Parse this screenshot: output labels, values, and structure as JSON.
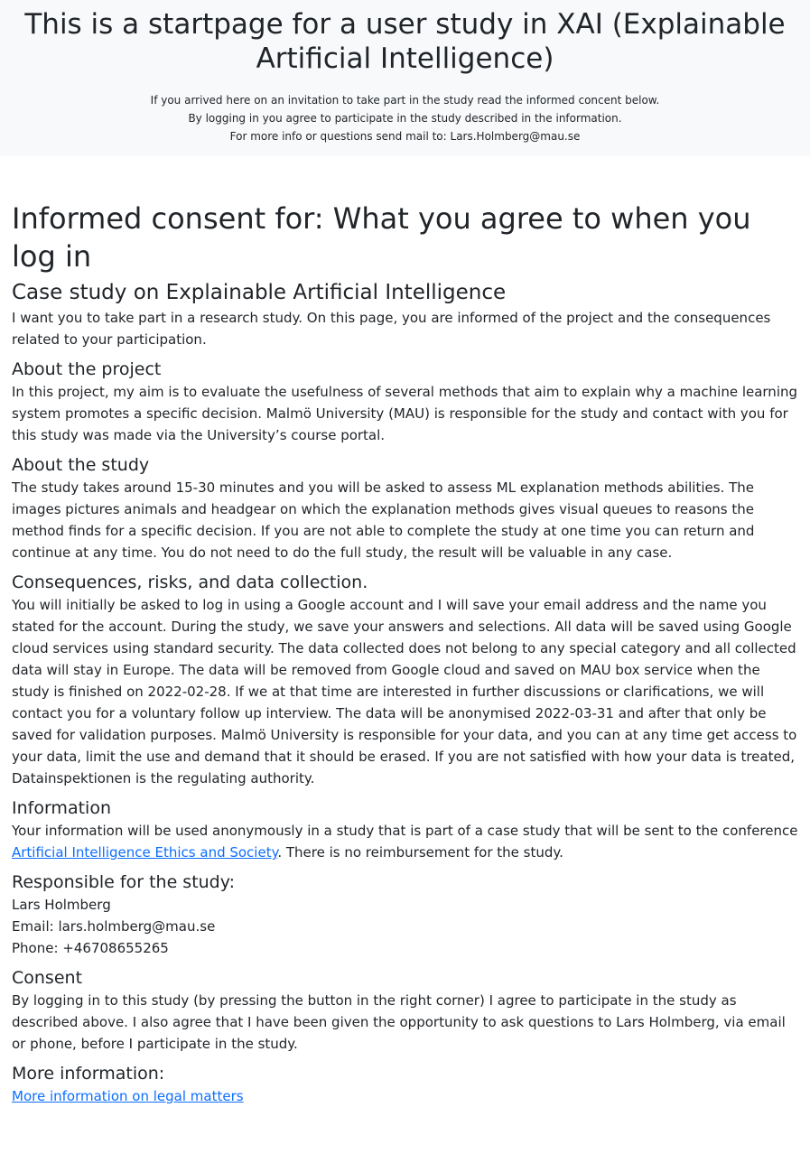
{
  "hero": {
    "title": "This is a startpage for a user study in XAI (Explainable Artificial Intelligence)",
    "line1": "If you arrived here on an invitation to take part in the study read the informed concent below.",
    "line2": "By logging in you agree to participate in the study described in the information.",
    "line3": "For more info or questions send mail to: Lars.Holmberg@mau.se"
  },
  "consent": {
    "heading": "Informed consent for: What you agree to when you log in",
    "subheading": "Case study on Explainable Artificial Intelligence",
    "intro": "I want you to take part in a research study. On this page, you are informed of the project and the consequences related to your participation.",
    "project_heading": "About the project",
    "project_text": "In this project, my aim is to evaluate the usefulness of several methods that aim to explain why a machine learning system promotes a specific decision. Malmö University (MAU) is responsible for the study and contact with you for this study was made via the University’s course portal.",
    "study_heading": "About the study",
    "study_text": "The study takes around 15-30 minutes and you will be asked to assess ML explanation methods abilities. The images pictures animals and headgear on which the explanation methods gives visual queues to reasons the method finds for a specific decision. If you are not able to complete the study at one time you can return and continue at any time. You do not need to do the full study, the result will be valuable in any case.",
    "risks_heading": "Consequences, risks, and data collection.",
    "risks_text": "You will initially be asked to log in using a Google account and I will save your email address and the name you stated for the account. During the study, we save your answers and selections. All data will be saved using Google cloud services using standard security. The data collected does not belong to any special category and all collected data will stay in Europe. The data will be removed from Google cloud and saved on MAU box service when the study is finished on 2022-02-28. If we at that time are interested in further discussions or clarifications, we will contact you for a voluntary follow up interview. The data will be anonymised 2022-03-31 and after that only be saved for validation purposes. Malmö University is responsible for your data, and you can at any time get access to your data, limit the use and demand that it should be erased. If you are not satisfied with how your data is treated, Datainspektionen is the regulating authority.",
    "info_heading": "Information",
    "info_text_before": "Your information will be used anonymously in a study that is part of a case study that will be sent to the conference ",
    "info_link": "Artificial Intelligence Ethics and Society",
    "info_text_after": ". There is no reimbursement for the study.",
    "responsible_heading": "Responsible for the study:",
    "responsible_name": "Lars Holmberg",
    "responsible_email": "Email: lars.holmberg@mau.se",
    "responsible_phone": "Phone: +46708655265",
    "consent_heading": "Consent",
    "consent_text": "By logging in to this study (by pressing the button in the right corner) I agree to participate in the study as described above. I also agree that I have been given the opportunity to ask questions to Lars Holmberg, via email or phone, before I participate in the study.",
    "more_heading": "More information:",
    "more_link": "More information on legal matters"
  },
  "colors": {
    "hero_bg": "#f8f9fa",
    "text": "#212529",
    "link": "#0d6efd"
  }
}
